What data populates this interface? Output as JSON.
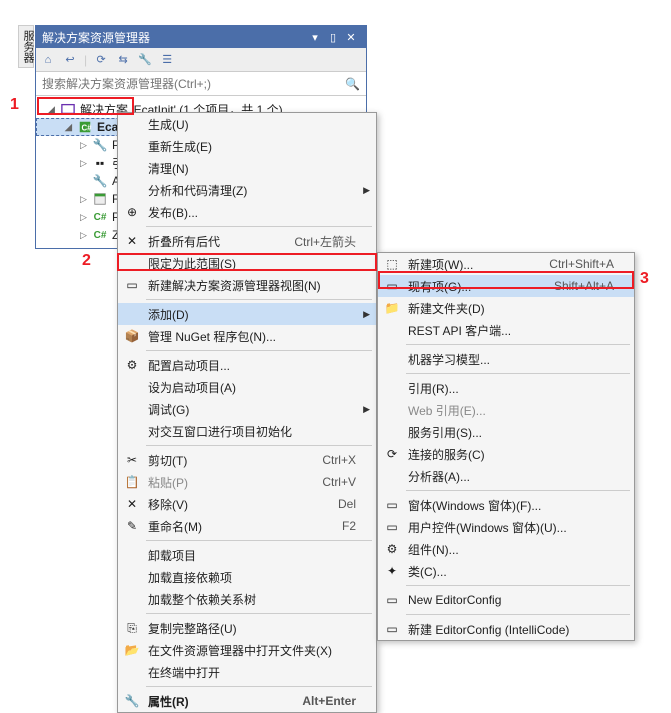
{
  "sideTab": "服务器",
  "panel": {
    "title": "解决方案资源管理器",
    "searchPlaceholder": "搜索解决方案资源管理器(Ctrl+;)",
    "solutionText": "解决方案 'EcatInit' (1 个项目，共 1 个)",
    "projectName": "EcatIn...",
    "nodes": {
      "prop": "Pro...",
      "ref": "引...",
      "app": "Ap...",
      "form": "Fo...",
      "prog": "Pro...",
      "zm": "Zm..."
    }
  },
  "menu1": {
    "build": "生成(U)",
    "rebuild": "重新生成(E)",
    "clean": "清理(N)",
    "analyze": "分析和代码清理(Z)",
    "publish": "发布(B)...",
    "collapse": "折叠所有后代",
    "collapseShort": "Ctrl+左箭头",
    "scope": "限定为此范围(S)",
    "newView": "新建解决方案资源管理器视图(N)",
    "add": "添加(D)",
    "nuget": "管理 NuGet 程序包(N)...",
    "configStartup": "配置启动项目...",
    "setStartup": "设为启动项目(A)",
    "debug": "调试(G)",
    "initInteractive": "对交互窗口进行项目初始化",
    "cut": "剪切(T)",
    "cutShort": "Ctrl+X",
    "paste": "粘贴(P)",
    "pasteShort": "Ctrl+V",
    "remove": "移除(V)",
    "removeShort": "Del",
    "rename": "重命名(M)",
    "renameShort": "F2",
    "unload": "卸载项目",
    "loadDeps": "加载直接依赖项",
    "loadTree": "加载整个依赖关系树",
    "copyPath": "复制完整路径(U)",
    "openExplorer": "在文件资源管理器中打开文件夹(X)",
    "openTerminal": "在终端中打开",
    "properties": "属性(R)",
    "propertiesShort": "Alt+Enter"
  },
  "menu2": {
    "newItem": "新建项(W)...",
    "newItemShort": "Ctrl+Shift+A",
    "existing": "现有项(G)...",
    "existingShort": "Shift+Alt+A",
    "newFolder": "新建文件夹(D)",
    "restClient": "REST API 客户端...",
    "mlModel": "机器学习模型...",
    "reference": "引用(R)...",
    "webRef": "Web 引用(E)...",
    "serviceRef": "服务引用(S)...",
    "connected": "连接的服务(C)",
    "analyzer": "分析器(A)...",
    "form": "窗体(Windows 窗体)(F)...",
    "userControl": "用户控件(Windows 窗体)(U)...",
    "component": "组件(N)...",
    "class": "类(C)...",
    "newEditorConfig": "New EditorConfig",
    "newEditorConfigIC": "新建 EditorConfig (IntelliCode)"
  },
  "annotations": {
    "n1": "1",
    "n2": "2",
    "n3": "3"
  }
}
